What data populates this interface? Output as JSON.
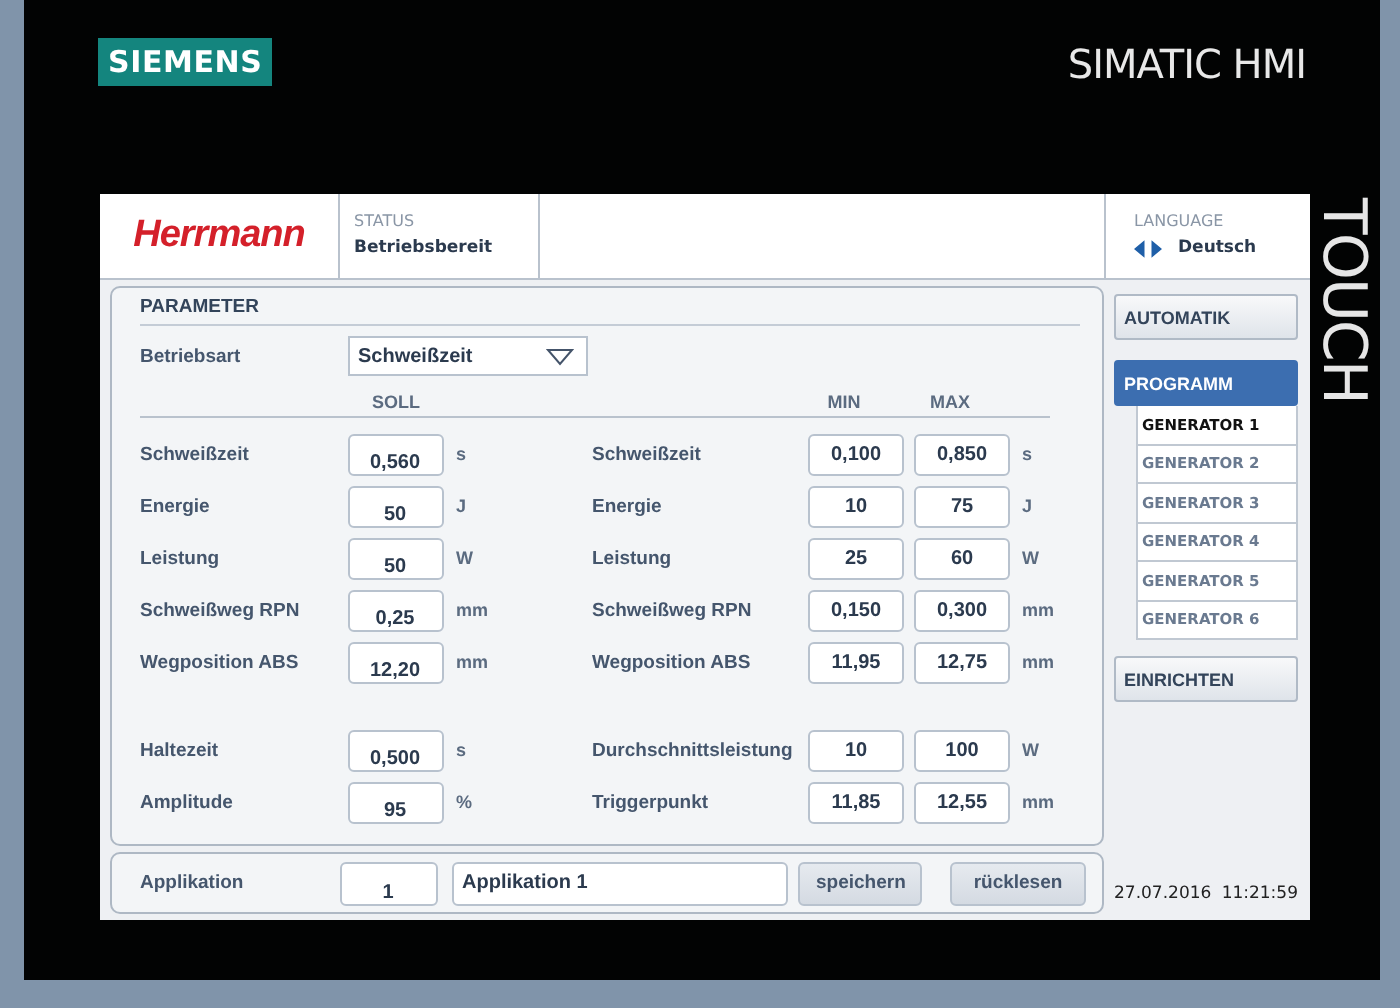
{
  "device": {
    "brand": "SIEMENS",
    "product": "SIMATIC HMI",
    "side_label": "TOUCH"
  },
  "header": {
    "logo": "Herrmann",
    "status_label": "STATUS",
    "status": "Betriebsbereit",
    "language_label": "LANGUAGE",
    "language": "Deutsch"
  },
  "parameter": {
    "title": "PARAMETER",
    "mode_label": "Betriebsart",
    "mode_value": "Schweißzeit",
    "soll_heading": "SOLL",
    "min_heading": "MIN",
    "max_heading": "MAX",
    "rows": [
      {
        "kind": "param",
        "soll_label": "Schweißzeit",
        "soll": "0,560",
        "soll_unit": "s",
        "limit_label": "Schweißzeit",
        "min": "0,100",
        "max": "0,850",
        "limit_unit": "s"
      },
      {
        "kind": "param",
        "soll_label": "Energie",
        "soll": "50",
        "soll_unit": "J",
        "limit_label": "Energie",
        "min": "10",
        "max": "75",
        "limit_unit": "J"
      },
      {
        "kind": "param",
        "soll_label": "Leistung",
        "soll": "50",
        "soll_unit": "W",
        "limit_label": "Leistung",
        "min": "25",
        "max": "60",
        "limit_unit": "W"
      },
      {
        "kind": "param",
        "soll_label": "Schweißweg RPN",
        "soll": "0,25",
        "soll_unit": "mm",
        "limit_label": "Schweißweg RPN",
        "min": "0,150",
        "max": "0,300",
        "limit_unit": "mm"
      },
      {
        "kind": "param",
        "soll_label": "Wegposition ABS",
        "soll": "12,20",
        "soll_unit": "mm",
        "limit_label": "Wegposition ABS",
        "min": "11,95",
        "max": "12,75",
        "limit_unit": "mm"
      },
      {
        "kind": "gap"
      },
      {
        "kind": "param",
        "soll_label": "Haltezeit",
        "soll": "0,500",
        "soll_unit": "s",
        "limit_label": "Durchschnittsleistung",
        "min": "10",
        "max": "100",
        "limit_unit": "W"
      },
      {
        "kind": "param",
        "soll_label": "Amplitude",
        "soll": "95",
        "soll_unit": "%",
        "limit_label": "Triggerpunkt",
        "min": "11,85",
        "max": "12,55",
        "limit_unit": "mm"
      }
    ]
  },
  "footer": {
    "label": "Applikation",
    "number": "1",
    "name": "Applikation 1",
    "buttons": [
      "speichern",
      "rücklesen"
    ]
  },
  "nav": [
    {
      "label": "AUTOMATIK",
      "selected": false
    },
    {
      "label": "PROGRAMM",
      "selected": true,
      "children": [
        {
          "label": "GENERATOR 1",
          "selected": true
        },
        {
          "label": "GENERATOR 2",
          "selected": false
        },
        {
          "label": "GENERATOR 3",
          "selected": false
        },
        {
          "label": "GENERATOR 4",
          "selected": false
        },
        {
          "label": "GENERATOR 5",
          "selected": false
        },
        {
          "label": "GENERATOR 6",
          "selected": false
        }
      ]
    },
    {
      "label": "EINRICHTEN",
      "selected": false
    }
  ],
  "status_bar": {
    "date": "27.07.2016",
    "time": "11:21:59"
  }
}
